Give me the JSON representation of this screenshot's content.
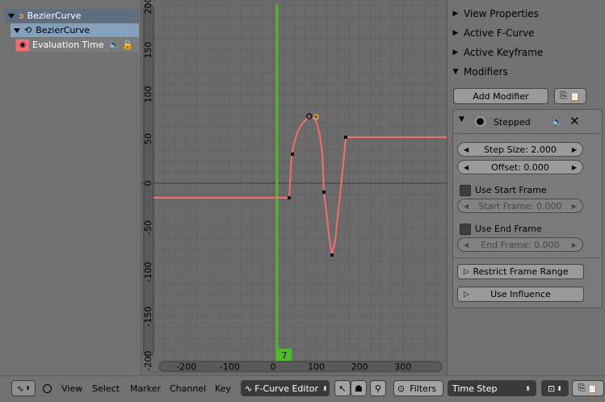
{
  "channels": {
    "object_label": "BezierCurve",
    "data_label": "BezierCurve",
    "curve_label": "Evaluation Time"
  },
  "graph": {
    "y_ticks": [
      "200",
      "150",
      "100",
      "50",
      "0",
      "-50",
      "-100",
      "-150",
      "-200"
    ],
    "x_ticks": [
      "-200",
      "-100",
      "0",
      "100",
      "200",
      "300"
    ],
    "current_frame": "7",
    "colors": {
      "curve": "#f56d6d",
      "playhead": "#4fba2b",
      "grid": "#636363"
    }
  },
  "panel": {
    "view_properties": "View Properties",
    "active_fcurve": "Active F-Curve",
    "active_keyframe": "Active Keyframe",
    "modifiers": "Modifiers",
    "add_modifier": "Add Modifier",
    "modifier_name": "Stepped",
    "step_size": "Step Size: 2.000",
    "offset": "Offset: 0.000",
    "use_start_frame": "Use Start Frame",
    "start_frame": "Start Frame: 0.000",
    "use_end_frame": "Use End Frame",
    "end_frame": "End Frame: 0.000",
    "restrict_frame_range": "Restrict Frame Range",
    "use_influence": "Use Influence"
  },
  "header": {
    "menus": [
      "View",
      "Select",
      "Marker",
      "Channel",
      "Key"
    ],
    "editor_mode": "F-Curve Editor",
    "filters": "Filters",
    "pivot": "Time Step"
  }
}
